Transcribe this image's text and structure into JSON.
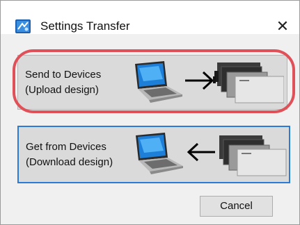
{
  "window": {
    "title": "Settings Transfer",
    "close_glyph": "✕"
  },
  "send_button": {
    "line1": "Send to Devices",
    "line2": "(Upload design)"
  },
  "get_button": {
    "line1": "Get from Devices",
    "line2": "(Download design)"
  },
  "cancel_label": "Cancel",
  "colors": {
    "highlight": "#e05058",
    "focus_border": "#2b7bd6"
  },
  "icons": [
    "app-icon",
    "laptop-icon",
    "arrow-right-icon",
    "arrow-left-icon",
    "devices-icon"
  ]
}
